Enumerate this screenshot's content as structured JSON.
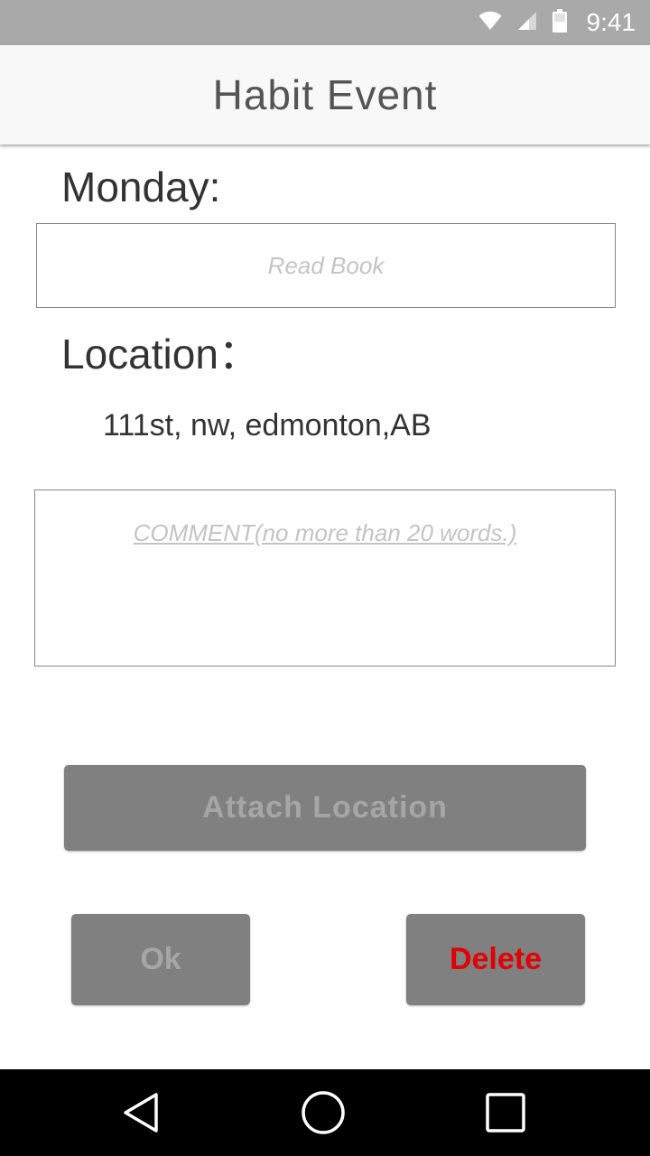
{
  "status_bar": {
    "time": "9:41",
    "icons": [
      "wifi-icon",
      "signal-icon",
      "battery-icon"
    ]
  },
  "app_bar": {
    "title": "Habit Event"
  },
  "form": {
    "day_label": "Monday:",
    "habit_placeholder": "Read Book",
    "location_label": "Location：",
    "location_value": "111st, nw, edmonton,AB",
    "comment_placeholder": "COMMENT(no more than 20 words.)"
  },
  "buttons": {
    "attach_location": "Attach Location",
    "ok": "Ok",
    "delete": "Delete"
  },
  "nav_bar": {
    "icons": [
      "back-icon",
      "home-icon",
      "recents-icon"
    ]
  },
  "colors": {
    "status_bar": "#a9a9a9",
    "app_bar": "#f8f8f8",
    "button_bg": "#808080",
    "button_text_disabled": "#a6a6a6",
    "delete_text": "#e00000",
    "nav_bar": "#000000"
  }
}
